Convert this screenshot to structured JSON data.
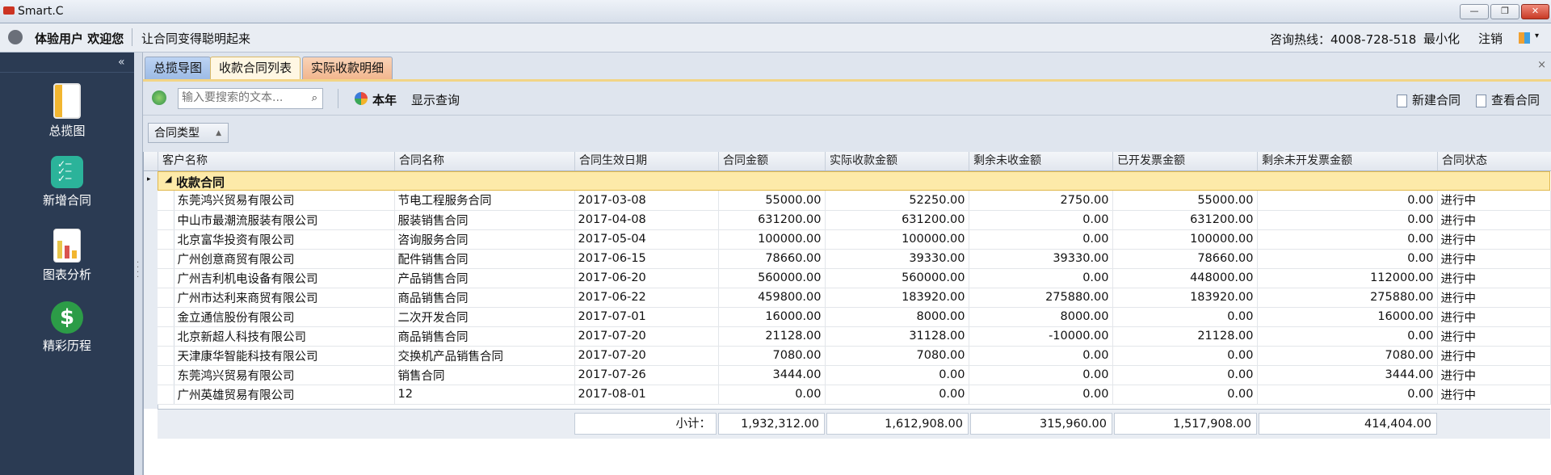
{
  "window": {
    "title": "Smart.C",
    "controls": [
      "—",
      "❐",
      "✕"
    ]
  },
  "header": {
    "user_welcome": "体验用户 欢迎您",
    "slogan": "让合同变得聪明起来",
    "hotline": "咨询热线：4008-728-518",
    "minimize": "最小化",
    "logout": "注销"
  },
  "sidebar": {
    "collapse_glyph": "«",
    "items": [
      {
        "label": "总揽图",
        "icon": "overview-icon",
        "color": "#f2b630"
      },
      {
        "label": "新增合同",
        "icon": "checklist-icon",
        "color": "#2bb39a"
      },
      {
        "label": "图表分析",
        "icon": "bar-chart-icon",
        "color": "#e8c64a"
      },
      {
        "label": "精彩历程",
        "icon": "dollar-badge-icon",
        "color": "#2c9c47"
      }
    ]
  },
  "tabs": [
    {
      "label": "总揽导图"
    },
    {
      "label": "收款合同列表"
    },
    {
      "label": "实际收款明细"
    }
  ],
  "tab_close": "×",
  "toolbar": {
    "search_placeholder": "输入要搜索的文本...",
    "search_glyph": "⌕",
    "year": "本年",
    "show_query": "显示查询",
    "new_contract": "新建合同",
    "view_contract": "查看合同"
  },
  "group_by": {
    "label": "合同类型",
    "arrow": "▲"
  },
  "grid": {
    "columns": [
      "客户名称",
      "合同名称",
      "合同生效日期",
      "合同金额",
      "实际收款金额",
      "剩余未收金额",
      "已开发票金额",
      "剩余未开发票金额",
      "合同状态"
    ],
    "group_row": {
      "marker": "▸",
      "expander": "◢",
      "label": "收款合同"
    },
    "rows": [
      [
        "东莞鸿兴贸易有限公司",
        "节电工程服务合同",
        "2017-03-08",
        "55000.00",
        "52250.00",
        "2750.00",
        "55000.00",
        "0.00",
        "进行中"
      ],
      [
        "中山市最潮流服装有限公司",
        "服装销售合同",
        "2017-04-08",
        "631200.00",
        "631200.00",
        "0.00",
        "631200.00",
        "0.00",
        "进行中"
      ],
      [
        "北京富华投资有限公司",
        "咨询服务合同",
        "2017-05-04",
        "100000.00",
        "100000.00",
        "0.00",
        "100000.00",
        "0.00",
        "进行中"
      ],
      [
        "广州创意商贸有限公司",
        "配件销售合同",
        "2017-06-15",
        "78660.00",
        "39330.00",
        "39330.00",
        "78660.00",
        "0.00",
        "进行中"
      ],
      [
        "广州吉利机电设备有限公司",
        "产品销售合同",
        "2017-06-20",
        "560000.00",
        "560000.00",
        "0.00",
        "448000.00",
        "112000.00",
        "进行中"
      ],
      [
        "广州市达利来商贸有限公司",
        "商品销售合同",
        "2017-06-22",
        "459800.00",
        "183920.00",
        "275880.00",
        "183920.00",
        "275880.00",
        "进行中"
      ],
      [
        "金立通信股份有限公司",
        "二次开发合同",
        "2017-07-01",
        "16000.00",
        "8000.00",
        "8000.00",
        "0.00",
        "16000.00",
        "进行中"
      ],
      [
        "北京新超人科技有限公司",
        "商品销售合同",
        "2017-07-20",
        "21128.00",
        "31128.00",
        "-10000.00",
        "21128.00",
        "0.00",
        "进行中"
      ],
      [
        "天津康华智能科技有限公司",
        "交换机产品销售合同",
        "2017-07-20",
        "7080.00",
        "7080.00",
        "0.00",
        "0.00",
        "7080.00",
        "进行中"
      ],
      [
        "东莞鸿兴贸易有限公司",
        "销售合同",
        "2017-07-26",
        "3444.00",
        "0.00",
        "0.00",
        "0.00",
        "3444.00",
        "进行中"
      ],
      [
        "广州英雄贸易有限公司",
        "12",
        "2017-08-01",
        "0.00",
        "0.00",
        "0.00",
        "0.00",
        "0.00",
        "进行中"
      ]
    ],
    "summary": {
      "label": "小计：",
      "contract_amount": "1,932,312.00",
      "received_amount": "1,612,908.00",
      "remaining_amount": "315,960.00",
      "invoiced_amount": "1,517,908.00",
      "uninvoiced_amount": "414,404.00"
    }
  }
}
